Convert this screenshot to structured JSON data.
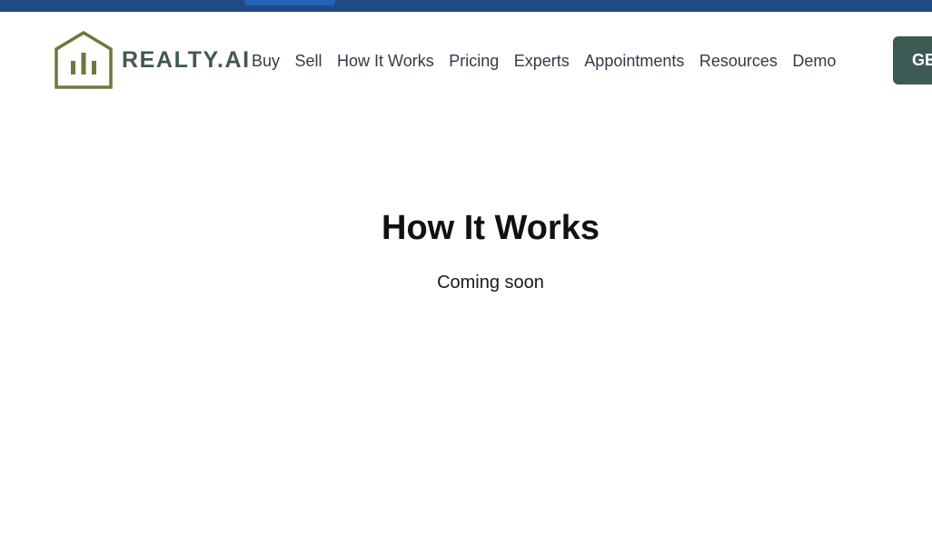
{
  "brand": {
    "name": "REALTY.AI",
    "icon": "house-bars-logo-icon",
    "color": "#6b7a3c",
    "text_color": "#3f5a4e"
  },
  "nav": {
    "items": [
      {
        "label": "Buy"
      },
      {
        "label": "Sell"
      },
      {
        "label": "How It Works"
      },
      {
        "label": "Pricing"
      },
      {
        "label": "Experts"
      },
      {
        "label": "Appointments"
      },
      {
        "label": "Resources"
      },
      {
        "label": "Demo"
      }
    ],
    "cta_label": "GE"
  },
  "main": {
    "title": "How It Works",
    "subtitle": "Coming soon"
  },
  "colors": {
    "top_strip": "#1f4a82",
    "cta_background": "#3e5a55"
  }
}
